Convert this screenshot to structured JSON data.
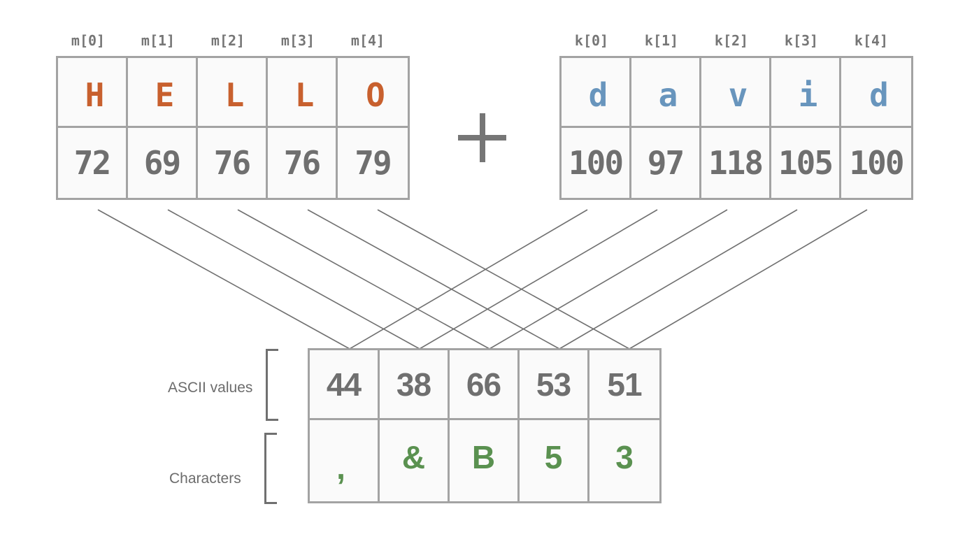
{
  "message": {
    "indices": [
      "m[0]",
      "m[1]",
      "m[2]",
      "m[3]",
      "m[4]"
    ],
    "chars": [
      "H",
      "E",
      "L",
      "L",
      "O"
    ],
    "ascii": [
      "72",
      "69",
      "76",
      "76",
      "79"
    ]
  },
  "operator": "+",
  "key": {
    "indices": [
      "k[0]",
      "k[1]",
      "k[2]",
      "k[3]",
      "k[4]"
    ],
    "chars": [
      "d",
      "a",
      "v",
      "i",
      "d"
    ],
    "ascii": [
      "100",
      "97",
      "118",
      "105",
      "100"
    ]
  },
  "result": {
    "ascii_label": "ASCII values",
    "chars_label": "Characters",
    "ascii": [
      "44",
      "38",
      "66",
      "53",
      "51"
    ],
    "chars": [
      ",",
      "&",
      "B",
      "5",
      "3"
    ]
  },
  "colors": {
    "message_char": "#c8602e",
    "key_char": "#6895bd",
    "result_char": "#5a9150",
    "number": "#6f6f6f",
    "border": "#a3a3a3",
    "line": "#707070"
  }
}
